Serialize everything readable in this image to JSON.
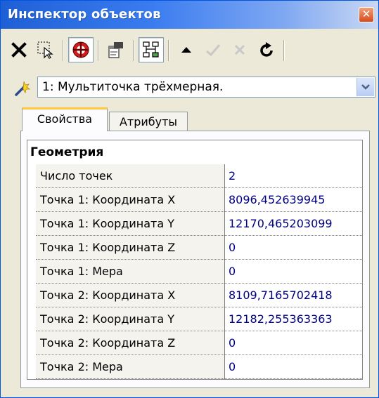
{
  "window": {
    "title": "Инспектор объектов",
    "close_symbol": "✕"
  },
  "toolbar": {
    "buttons": [
      {
        "name": "delete-icon"
      },
      {
        "name": "select-icon"
      },
      {
        "name": "target-icon",
        "pressed": true
      },
      {
        "name": "properties-icon"
      },
      {
        "name": "tree-icon",
        "pressed": true
      },
      {
        "name": "arrow-up-icon"
      },
      {
        "name": "apply-icon",
        "disabled": true
      },
      {
        "name": "cancel-icon",
        "disabled": true
      },
      {
        "name": "refresh-icon"
      }
    ]
  },
  "object_selector": {
    "icon": "wand-icon",
    "value": "1: Мультиточка трёхмерная."
  },
  "tabs": [
    {
      "label": "Свойства",
      "active": true
    },
    {
      "label": "Атрибуты",
      "active": false
    }
  ],
  "properties": {
    "group": "Геометрия",
    "rows": [
      {
        "name": "Число точек",
        "value": "2"
      },
      {
        "name": "Точка 1: Координата X",
        "value": "8096,452639945"
      },
      {
        "name": "Точка 1: Координата Y",
        "value": "12170,465203099"
      },
      {
        "name": "Точка 1: Координата Z",
        "value": "0"
      },
      {
        "name": "Точка 1: Мера",
        "value": "0"
      },
      {
        "name": "Точка 2: Координата X",
        "value": "8109,7165702418"
      },
      {
        "name": "Точка 2: Координата Y",
        "value": "12182,255363363"
      },
      {
        "name": "Точка 2: Координата Z",
        "value": "0"
      },
      {
        "name": "Точка 2: Мера",
        "value": "0"
      }
    ]
  },
  "colors": {
    "title_bar": "#2a6ae0",
    "value_text": "#000080",
    "active_tab_accent": "#ffc83c"
  }
}
